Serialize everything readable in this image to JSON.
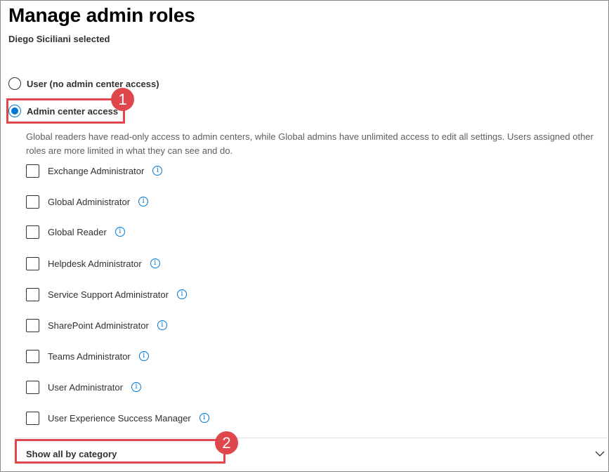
{
  "page": {
    "title": "Manage admin roles",
    "subtitle": "Diego Siciliani selected"
  },
  "access_options": [
    {
      "label": "User (no admin center access)",
      "checked": false
    },
    {
      "label": "Admin center access",
      "checked": true
    }
  ],
  "description": "Global readers have read-only access to admin centers, while Global admins have unlimited access to edit all settings. Users assigned other roles are more limited in what they can see and do.",
  "roles": [
    {
      "label": "Exchange Administrator",
      "checked": false
    },
    {
      "label": "Global Administrator",
      "checked": false
    },
    {
      "label": "Global Reader",
      "checked": false
    },
    {
      "label": "Helpdesk Administrator",
      "checked": false
    },
    {
      "label": "Service Support Administrator",
      "checked": false
    },
    {
      "label": "SharePoint Administrator",
      "checked": false
    },
    {
      "label": "Teams Administrator",
      "checked": false
    },
    {
      "label": "User Administrator",
      "checked": false
    },
    {
      "label": "User Experience Success Manager",
      "checked": false
    }
  ],
  "info_glyph": "i",
  "footer": {
    "show_all_label": "Show all by category",
    "icon": "chevron-down-icon"
  },
  "annotations": [
    {
      "number": "1"
    },
    {
      "number": "2"
    }
  ],
  "colors": {
    "accent": "#0078d4",
    "annotation": "#e0474c"
  }
}
